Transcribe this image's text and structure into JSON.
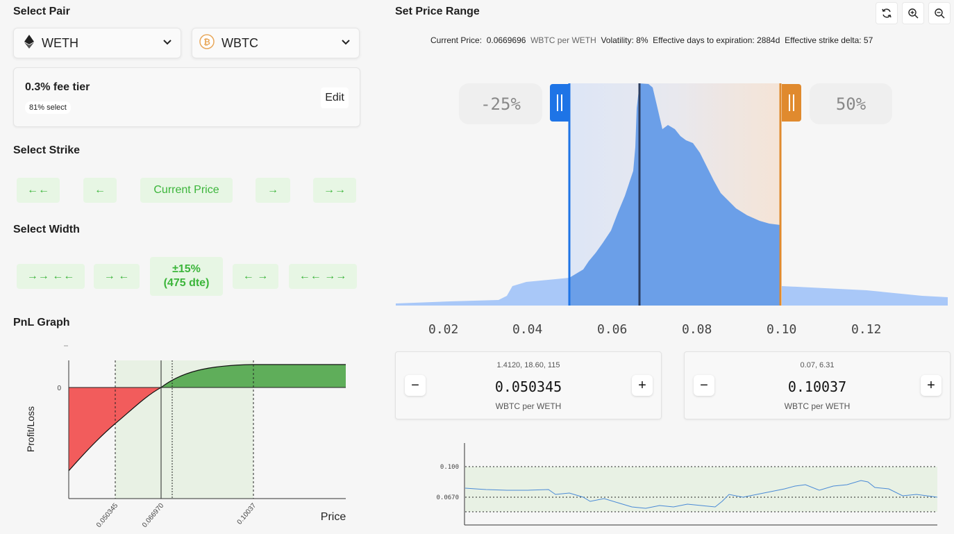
{
  "pair": {
    "heading": "Select Pair",
    "token_a": "WETH",
    "token_b": "WBTC",
    "fee_tier": "0.3% fee tier",
    "fee_badge": "81% select",
    "edit_label": "Edit"
  },
  "strike": {
    "heading": "Select Strike",
    "buttons": [
      "←←",
      "←",
      "Current Price",
      "→",
      "→→"
    ]
  },
  "width": {
    "heading": "Select Width",
    "buttons": [
      "→→ ←←",
      "→ ←",
      "±15%",
      "(475 dte)",
      "← →",
      "←← →→"
    ]
  },
  "pnl": {
    "heading": "PnL Graph",
    "ylabel": "Profit/Loss",
    "xlabel": "Price",
    "zero_label": "0",
    "x_ticks": [
      "0.050345",
      "0.066970",
      "0.10037"
    ]
  },
  "range": {
    "heading": "Set Price Range",
    "info": {
      "current_price_label": "Current Price:",
      "current_price": "0.0669696",
      "unit": "WBTC per WETH",
      "volatility": "Volatility: 8%",
      "days": "Effective days to expiration: 2884d",
      "delta": "Effective strike delta: 57"
    },
    "lower_pct": "-25%",
    "upper_pct": "50%",
    "ticks": [
      "0.02",
      "0.04",
      "0.06",
      "0.08",
      "0.10",
      "0.12"
    ],
    "lower": {
      "top": "1.4120, 18.60, 115",
      "value": "0.050345",
      "unit": "WBTC per WETH"
    },
    "upper": {
      "top": "0.07, 6.31",
      "value": "0.10037",
      "unit": "WBTC per WETH"
    },
    "minus": "−",
    "plus": "+"
  },
  "mini_chart": {
    "labels": [
      "0.100",
      "0.0670"
    ]
  },
  "colors": {
    "accent_green": "#3bb53a",
    "lower_handle": "#1e74e6",
    "upper_handle": "#e08a2e",
    "loss": "#f25c5c",
    "profit": "#5fae5a"
  }
}
